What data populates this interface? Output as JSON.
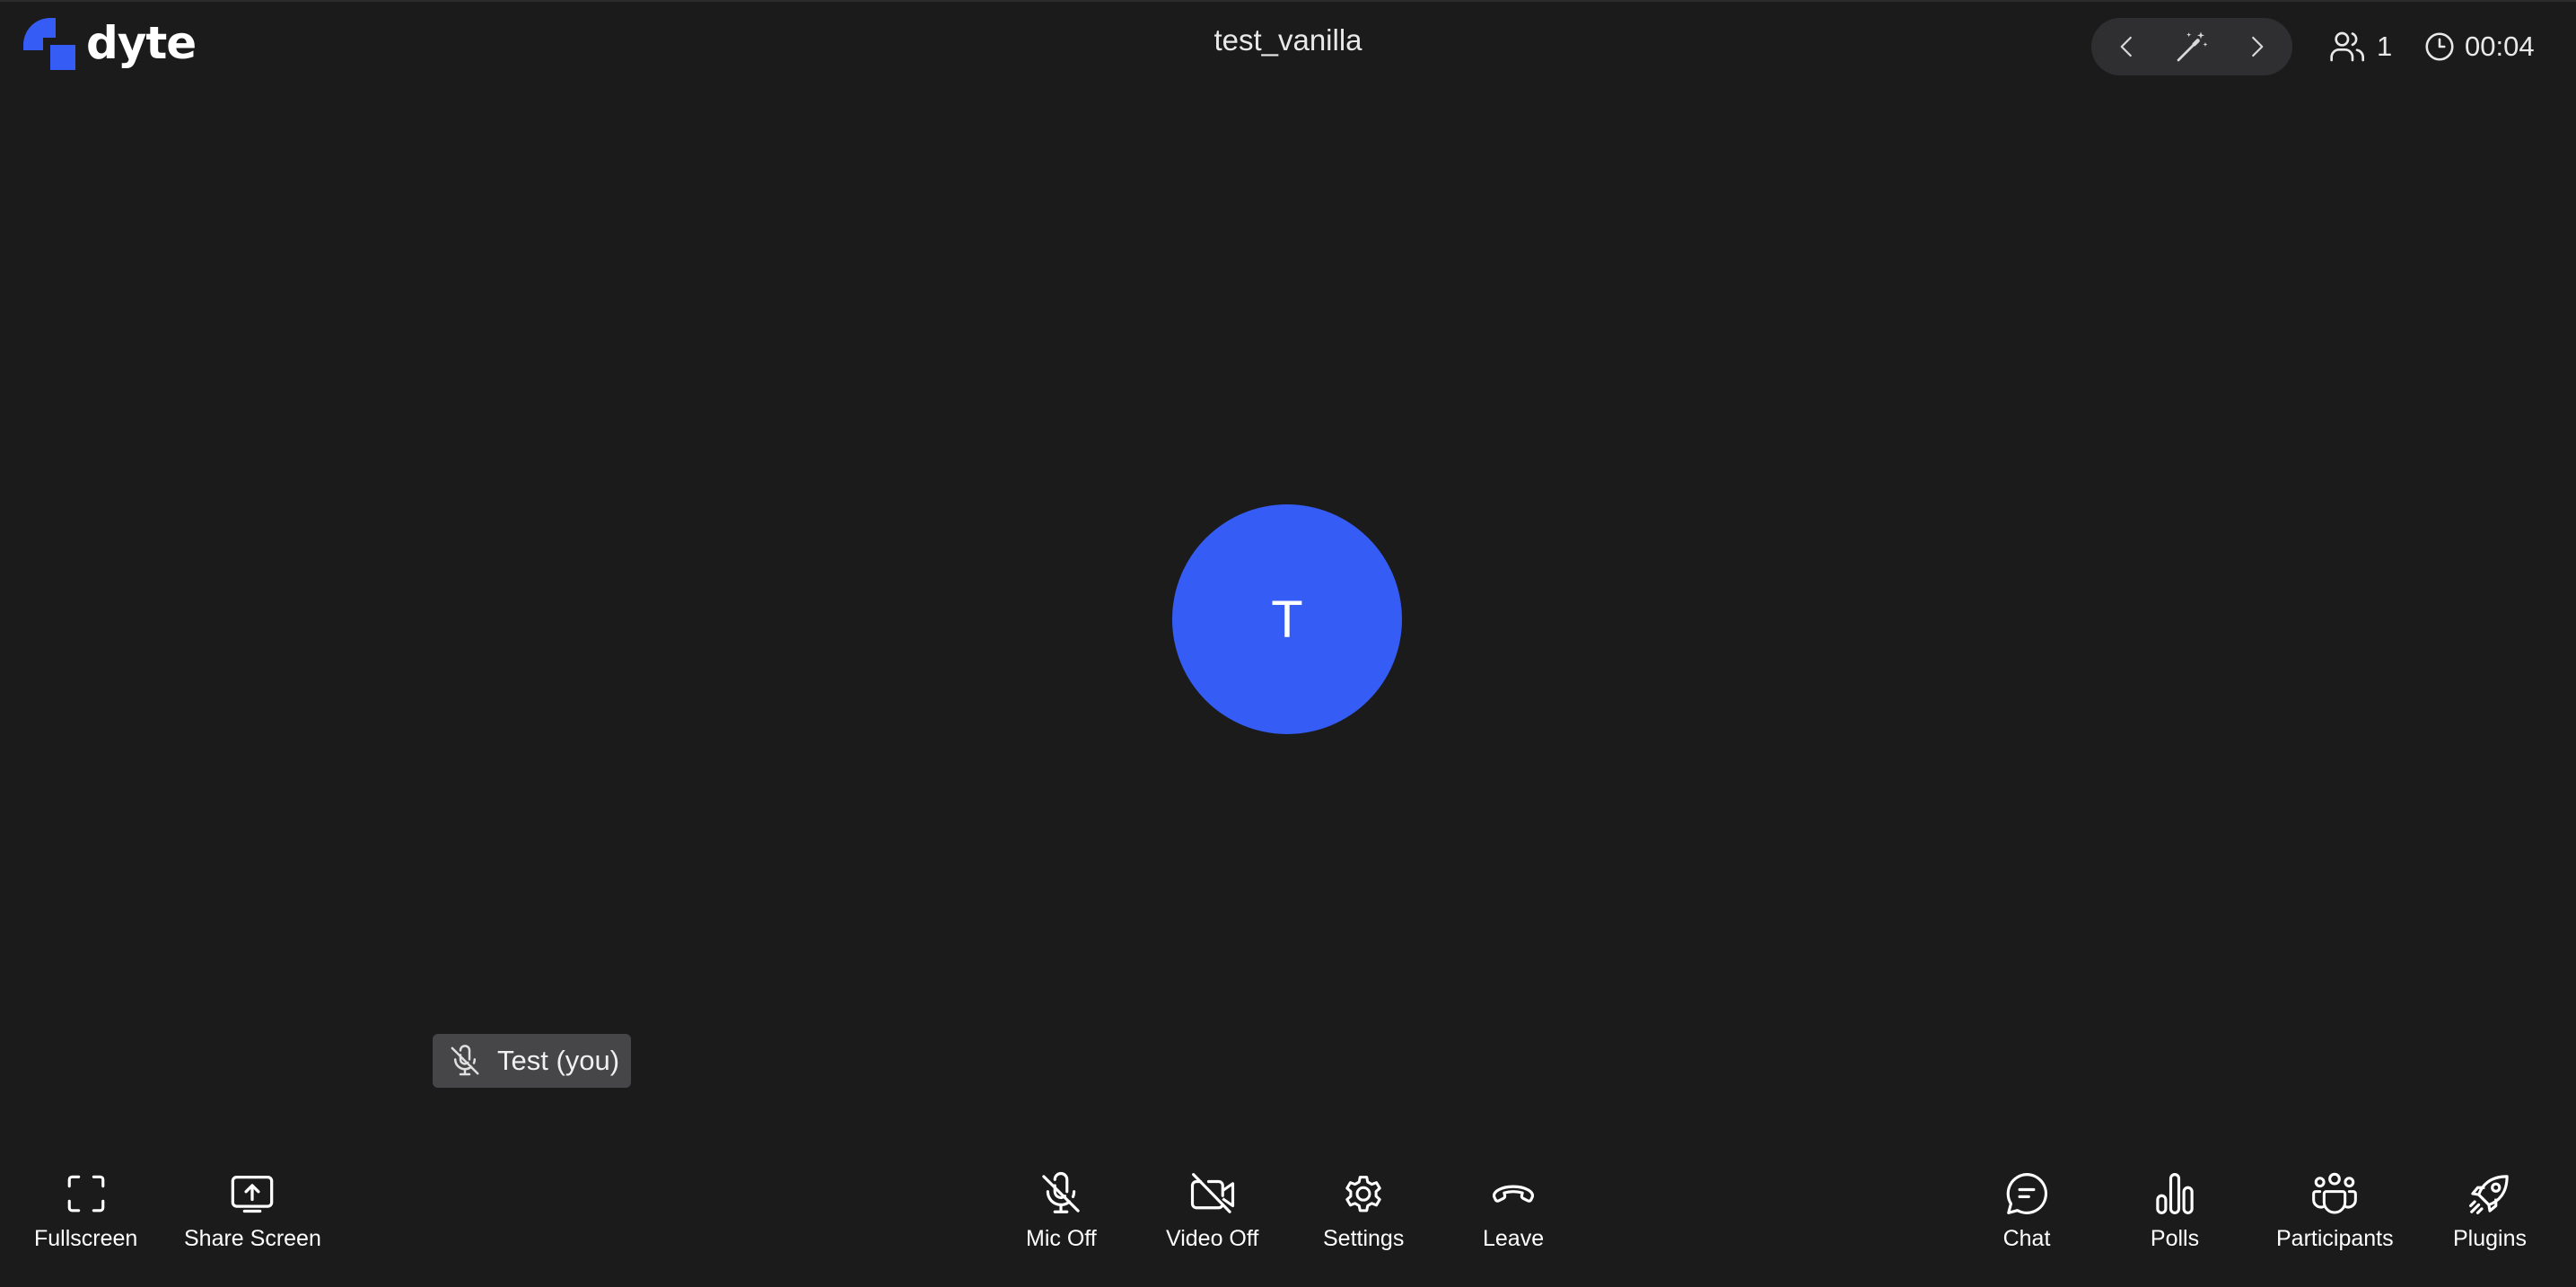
{
  "header": {
    "brand": "dyte",
    "meeting_title": "test_vanilla",
    "participant_count": "1",
    "timer": "00:04"
  },
  "colors": {
    "background": "#1b1b1c",
    "brand_blue": "#355df5",
    "pill": "#2f2f31",
    "name_tag": "#464648"
  },
  "stage": {
    "avatar_initial": "T",
    "name_tag": "Test (you)"
  },
  "controls": {
    "left": [
      {
        "label": "Fullscreen",
        "icon": "fullscreen-icon"
      },
      {
        "label": "Share Screen",
        "icon": "share-screen-icon"
      }
    ],
    "center": [
      {
        "label": "Mic Off",
        "icon": "mic-off-icon"
      },
      {
        "label": "Video Off",
        "icon": "video-off-icon"
      },
      {
        "label": "Settings",
        "icon": "gear-icon"
      },
      {
        "label": "Leave",
        "icon": "phone-hangup-icon"
      }
    ],
    "right": [
      {
        "label": "Chat",
        "icon": "chat-icon"
      },
      {
        "label": "Polls",
        "icon": "poll-icon"
      },
      {
        "label": "Participants",
        "icon": "participants-icon"
      },
      {
        "label": "Plugins",
        "icon": "rocket-icon"
      }
    ]
  }
}
